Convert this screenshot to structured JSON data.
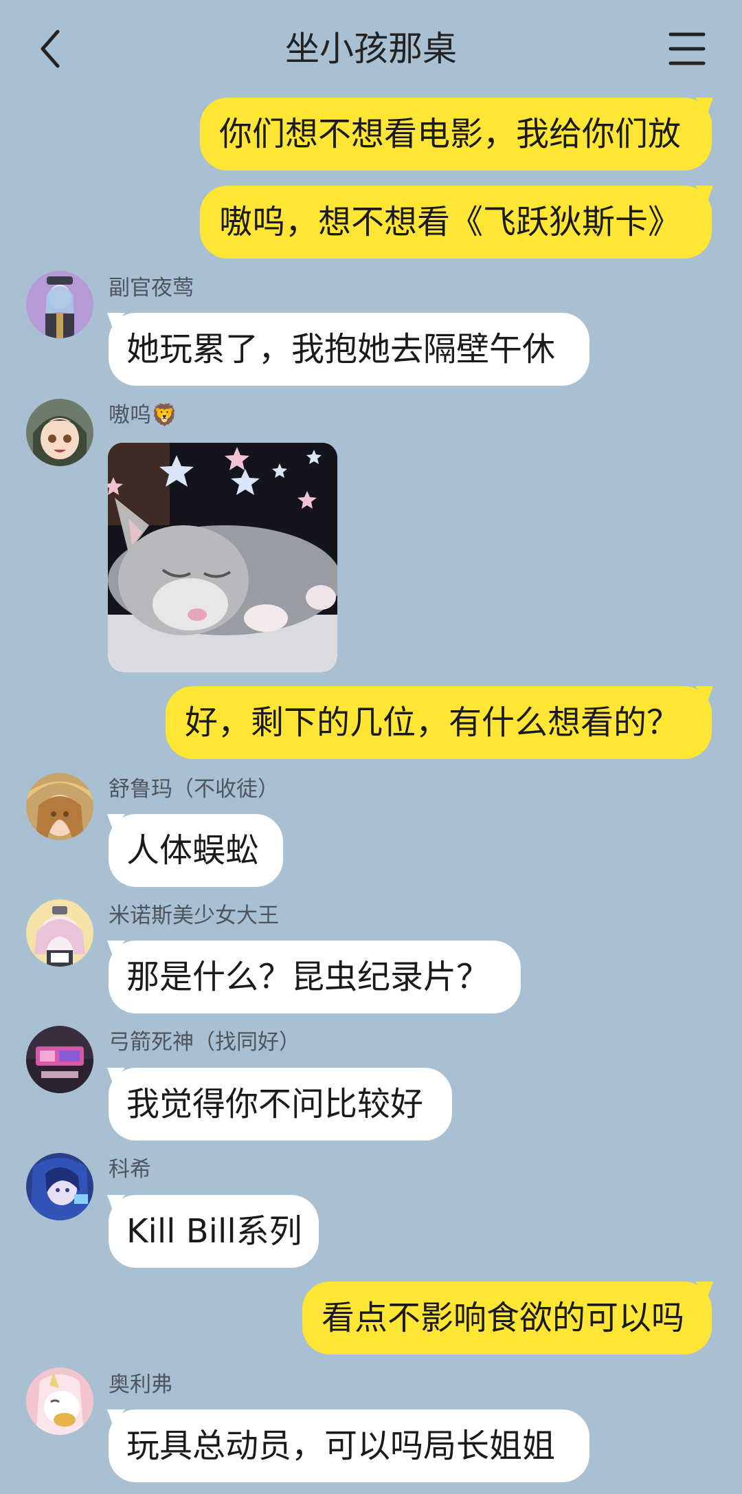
{
  "header": {
    "title": "坐小孩那桌",
    "back_icon": "chevron-left-icon",
    "menu_icon": "hamburger-menu-icon"
  },
  "messages": [
    {
      "side": "me",
      "text": "你们想不想看电影，我给你们放"
    },
    {
      "side": "me",
      "text": "嗷呜，想不想看《飞跃狄斯卡》"
    },
    {
      "side": "other",
      "sender": "副官夜莺",
      "text": "她玩累了，我抱她去隔壁午休"
    },
    {
      "side": "other",
      "sender": "嗷呜🦁",
      "image": "sleeping-kitten-photo"
    },
    {
      "side": "me",
      "text": "好，剩下的几位，有什么想看的？"
    },
    {
      "side": "other",
      "sender": "舒鲁玛（不收徒）",
      "text": "人体蜈蚣"
    },
    {
      "side": "other",
      "sender": "米诺斯美少女大王",
      "text": "那是什么？昆虫纪录片？"
    },
    {
      "side": "other",
      "sender": "弓箭死神（找同好）",
      "text": "我觉得你不问比较好"
    },
    {
      "side": "other",
      "sender": "科希",
      "text": "Kill Bill系列"
    },
    {
      "side": "me",
      "text": "看点不影响食欲的可以吗"
    },
    {
      "side": "other",
      "sender": "奥利弗",
      "text": "玩具总动员，可以吗局长姐姐"
    }
  ],
  "colors": {
    "background": "#a9bfd2",
    "my_bubble": "#ffe634",
    "other_bubble": "#ffffff"
  }
}
